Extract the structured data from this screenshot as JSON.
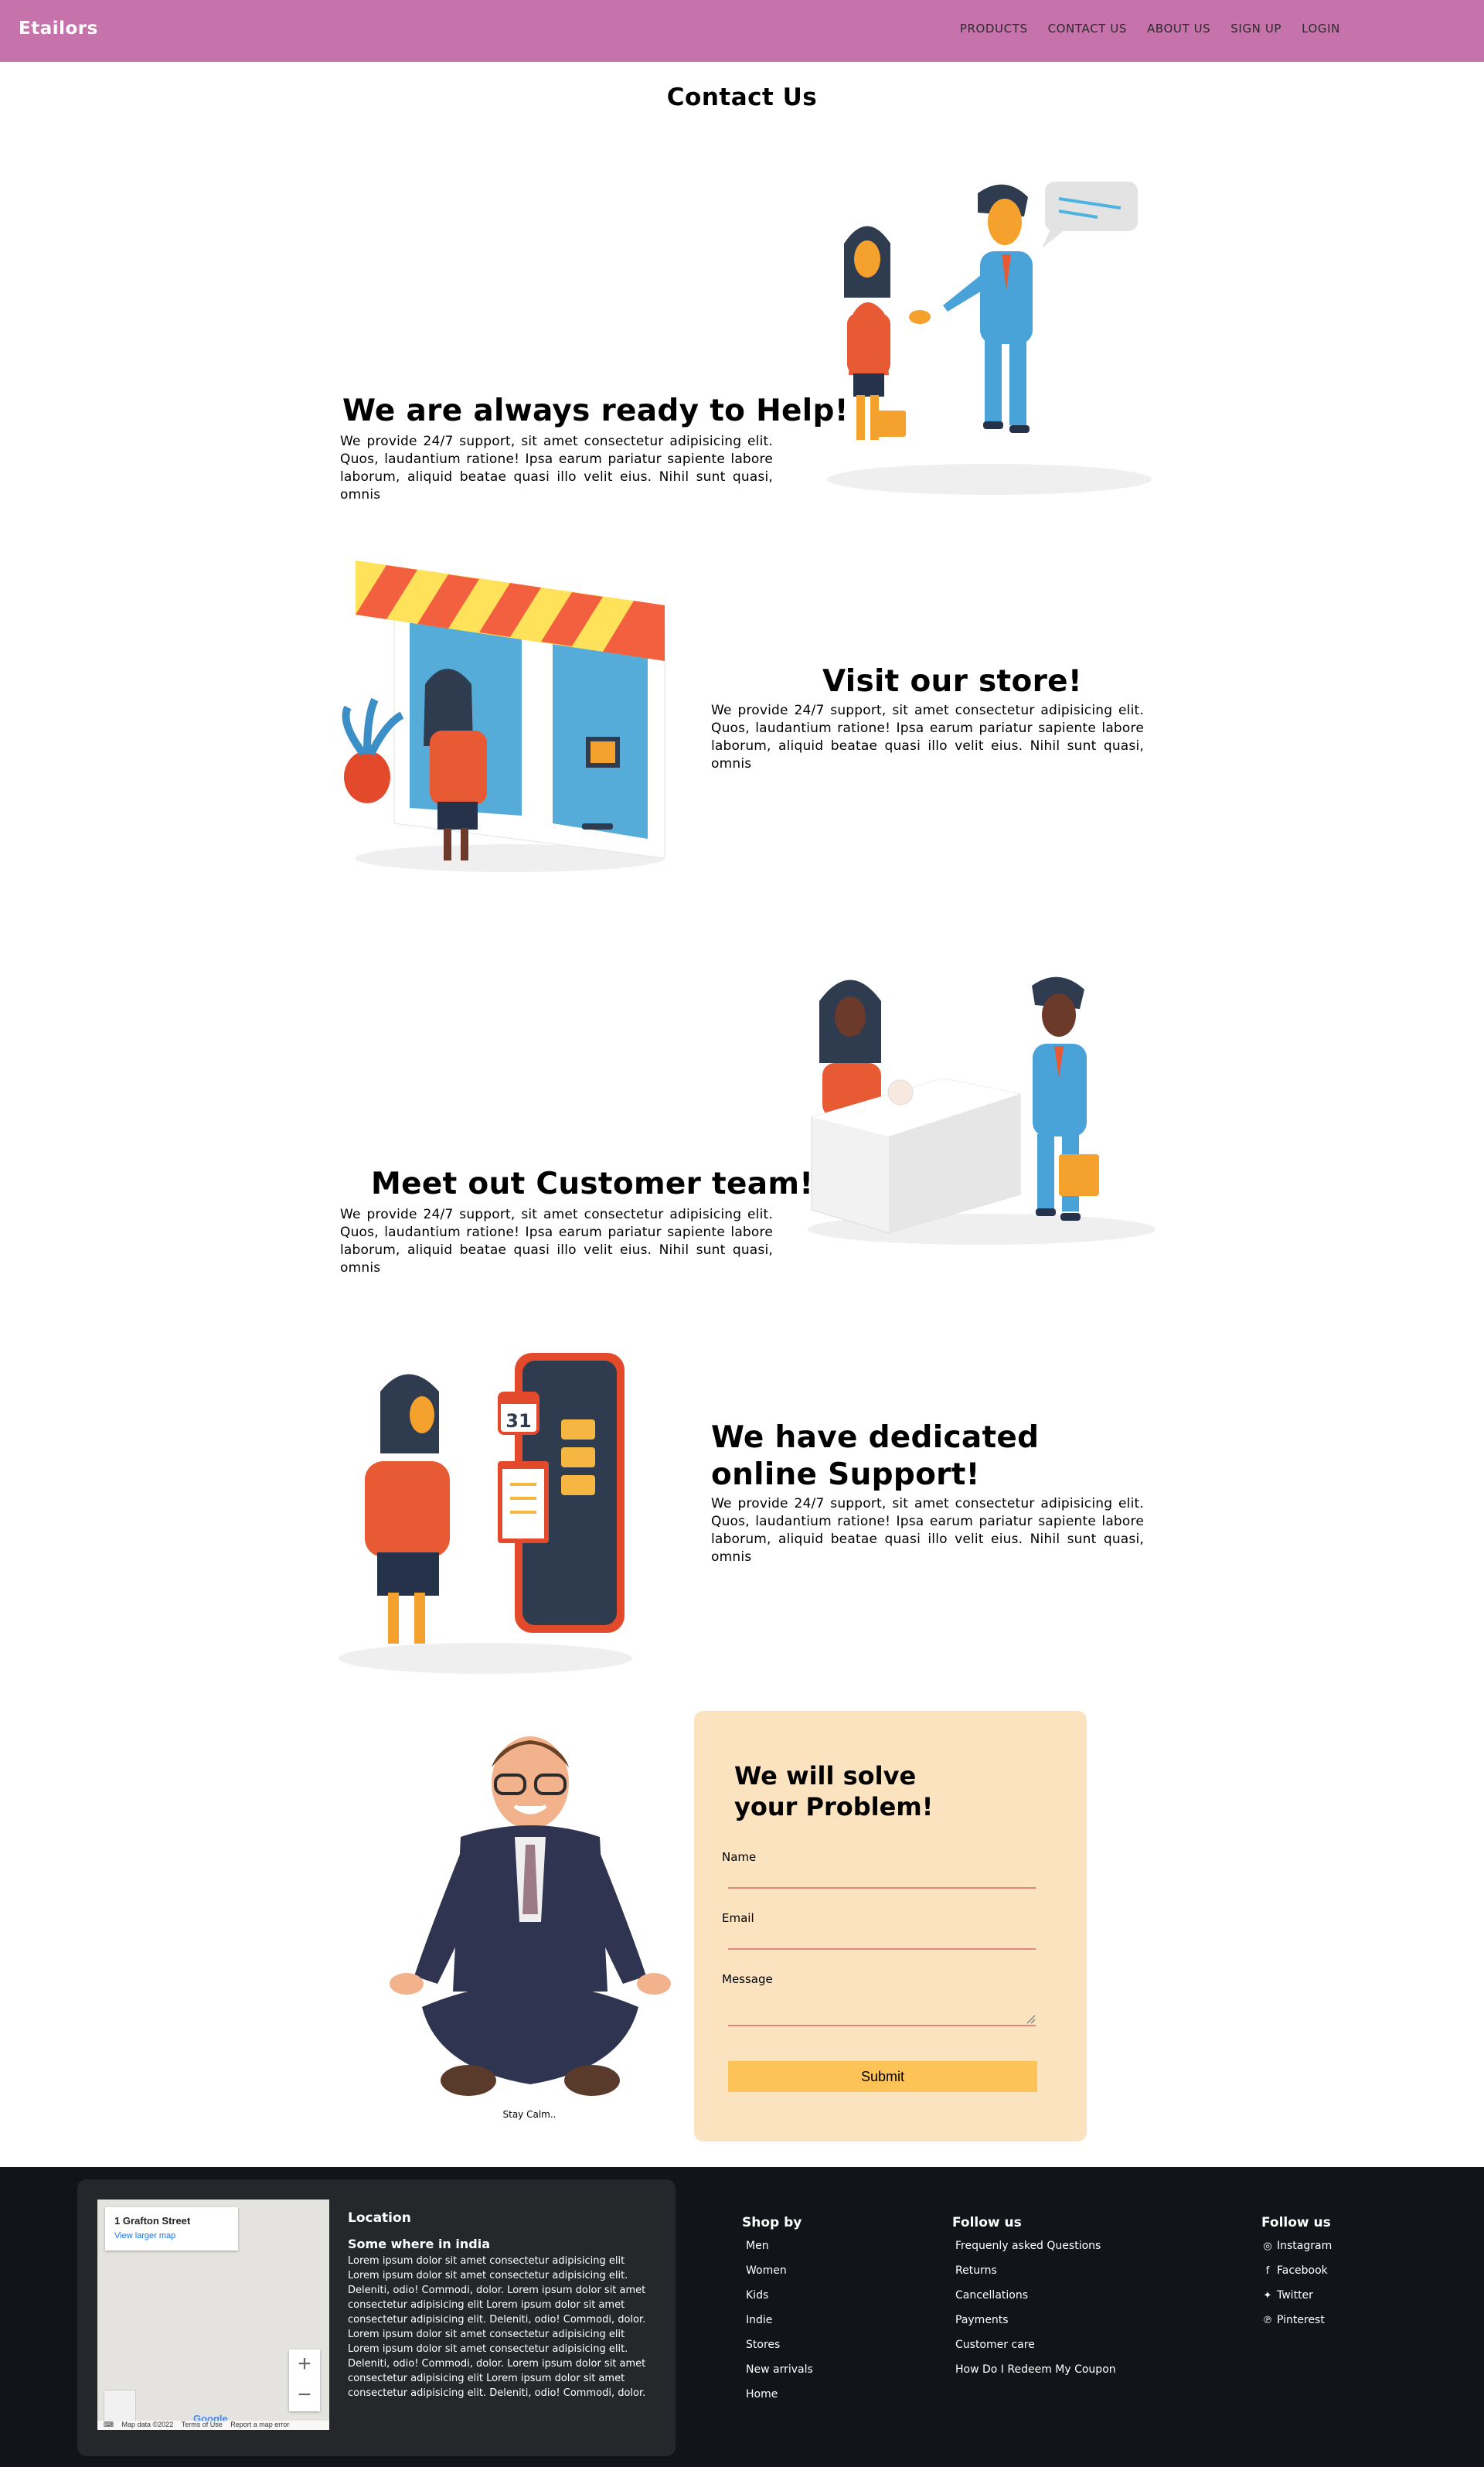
{
  "navbar": {
    "brand": "Etailors",
    "links": [
      "PRODUCTS",
      "CONTACT US",
      "ABOUT US",
      "SIGN UP",
      "LOGIN"
    ]
  },
  "page_title": "Contact Us",
  "sections": [
    {
      "heading": "We are always ready to Help!",
      "text": "We provide 24/7 support, sit amet consectetur adipisicing elit. Quos, laudantium ratione! Ipsa earum pariatur sapiente labore laborum, aliquid beatae quasi illo velit eius. Nihil sunt quasi, omnis"
    },
    {
      "heading": "Visit our store!",
      "text": "We provide 24/7 support, sit amet consectetur adipisicing elit. Quos, laudantium ratione! Ipsa earum pariatur sapiente labore laborum, aliquid beatae quasi illo velit eius. Nihil sunt quasi, omnis"
    },
    {
      "heading": "Meet out Customer team!",
      "text": "We provide 24/7 support, sit amet consectetur adipisicing elit. Quos, laudantium ratione! Ipsa earum pariatur sapiente labore laborum, aliquid beatae quasi illo velit eius. Nihil sunt quasi, omnis"
    },
    {
      "heading": "We have dedicated online Support!",
      "text": "We provide 24/7 support, sit amet consectetur adipisicing elit. Quos, laudantium ratione! Ipsa earum pariatur sapiente labore laborum, aliquid beatae quasi illo velit eius. Nihil sunt quasi, omnis"
    }
  ],
  "calm_caption": "Stay Calm..",
  "form": {
    "heading": "We will solve your Problem!",
    "name_label": "Name",
    "email_label": "Email",
    "message_label": "Message",
    "submit_label": "Submit"
  },
  "footer": {
    "map": {
      "address": "1 Grafton Street",
      "larger_map": "View larger map",
      "zoom_in": "+",
      "zoom_out": "−",
      "google": "Google",
      "map_data": "Map data ©2022",
      "terms": "Terms of Use",
      "report": "Report a map error"
    },
    "location_title": "Location",
    "location_sub": "Some where in india",
    "location_text": "Lorem ipsum dolor sit amet consectetur adipisicing elit Lorem ipsum dolor sit amet consectetur adipisicing elit. Deleniti, odio! Commodi, dolor. Lorem ipsum dolor sit amet consectetur adipisicing elit Lorem ipsum dolor sit amet consectetur adipisicing elit. Deleniti, odio! Commodi, dolor. Lorem ipsum dolor sit amet consectetur adipisicing elit Lorem ipsum dolor sit amet consectetur adipisicing elit. Deleniti, odio! Commodi, dolor. Lorem ipsum dolor sit amet consectetur adipisicing elit Lorem ipsum dolor sit amet consectetur adipisicing elit. Deleniti, odio! Commodi, dolor.",
    "shop_by": {
      "title": "Shop by",
      "items": [
        "Men",
        "Women",
        "Kids",
        "Indie",
        "Stores",
        "New arrivals",
        "Home"
      ]
    },
    "help": {
      "title": "Follow us",
      "items": [
        "Frequenly asked Questions",
        "Returns",
        "Cancellations",
        "Payments",
        "Customer care",
        "How Do I Redeem My Coupon"
      ]
    },
    "social": {
      "title": "Follow us",
      "items": [
        {
          "icon": "instagram-icon",
          "label": "Instagram"
        },
        {
          "icon": "facebook-icon",
          "label": "Facebook"
        },
        {
          "icon": "twitter-icon",
          "label": "Twitter"
        },
        {
          "icon": "pinterest-icon",
          "label": "Pinterest"
        }
      ]
    }
  },
  "colors": {
    "navbar": "#c672ab",
    "form_bg": "#fce3c0",
    "submit_bg": "#fdc356",
    "footer_bg": "#131419",
    "location_card": "#26272a"
  }
}
